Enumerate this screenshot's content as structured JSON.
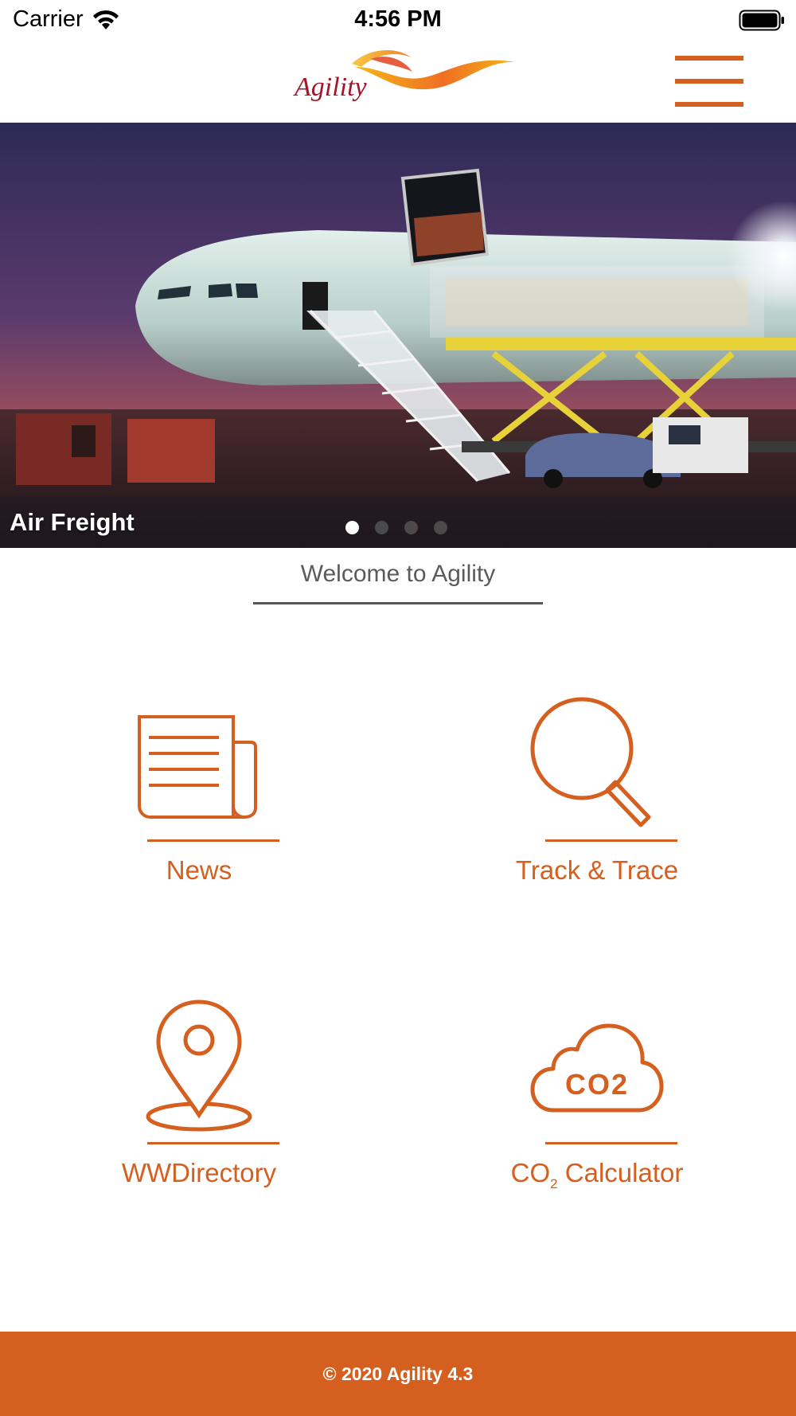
{
  "status_bar": {
    "carrier": "Carrier",
    "time": "4:56 PM"
  },
  "header": {
    "logo_text": "Agility",
    "menu_icon": "hamburger-menu-icon"
  },
  "carousel": {
    "caption": "Air Freight",
    "slide_count": 4,
    "active_index": 0
  },
  "welcome": {
    "text": "Welcome to Agility"
  },
  "tiles": [
    {
      "label": "News",
      "icon": "newspaper-icon"
    },
    {
      "label": "Track & Trace",
      "icon": "magnifier-icon"
    },
    {
      "label": "WWDirectory",
      "icon": "map-pin-icon"
    },
    {
      "label_main": "CO",
      "label_sub": "2",
      "label_rest": " Calculator",
      "icon": "co2-cloud-icon",
      "icon_text": "CO2"
    }
  ],
  "footer": {
    "text": "© 2020 Agility 4.3"
  },
  "colors": {
    "accent": "#d55f1f",
    "text_gray": "#5b5b5b",
    "background": "#ffffff"
  }
}
